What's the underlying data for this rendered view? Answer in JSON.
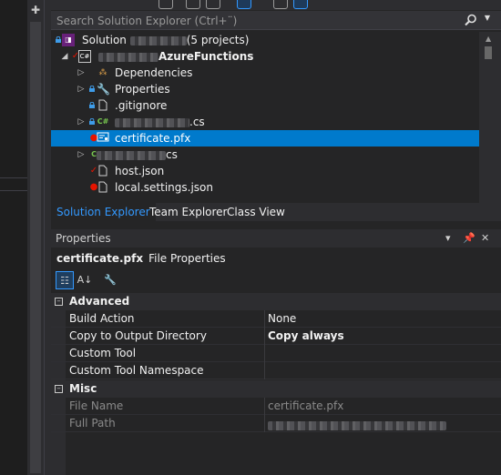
{
  "search": {
    "placeholder": "Search Solution Explorer (Ctrl+¨)"
  },
  "tree": {
    "solution": {
      "label": "Solution",
      "suffix": "(5 projects)"
    },
    "project": {
      "label": "AzureFunctions"
    },
    "items": [
      {
        "label": "Dependencies",
        "icon": "dependencies-icon"
      },
      {
        "label": "Properties",
        "icon": "wrench-icon"
      },
      {
        "label": ".gitignore",
        "icon": "file-icon"
      },
      {
        "label": ".cs",
        "icon": "csharp-file-icon"
      },
      {
        "label": "certificate.pfx",
        "icon": "certificate-icon"
      },
      {
        "label": "cs",
        "icon": "csharp-file-icon"
      },
      {
        "label": "host.json",
        "icon": "json-file-icon"
      },
      {
        "label": "local.settings.json",
        "icon": "json-file-icon"
      }
    ]
  },
  "tabs": [
    "Solution Explorer",
    "Team Explorer",
    "Class View"
  ],
  "properties": {
    "title": "Properties",
    "object_name": "certificate.pfx",
    "object_type": "File Properties",
    "categories": [
      {
        "name": "Advanced",
        "rows": [
          {
            "key": "Build Action",
            "value": "None"
          },
          {
            "key": "Copy to Output Directory",
            "value": "Copy always"
          },
          {
            "key": "Custom Tool",
            "value": ""
          },
          {
            "key": "Custom Tool Namespace",
            "value": ""
          }
        ]
      },
      {
        "name": "Misc",
        "rows": [
          {
            "key": "File Name",
            "value": "certificate.pfx"
          },
          {
            "key": "Full Path",
            "value": ""
          }
        ]
      }
    ]
  },
  "colors": {
    "background": "#252526",
    "selection": "#007acc",
    "active_tab": "#3399ff",
    "git_added": "#e51400",
    "git_modified": "#e51400"
  }
}
